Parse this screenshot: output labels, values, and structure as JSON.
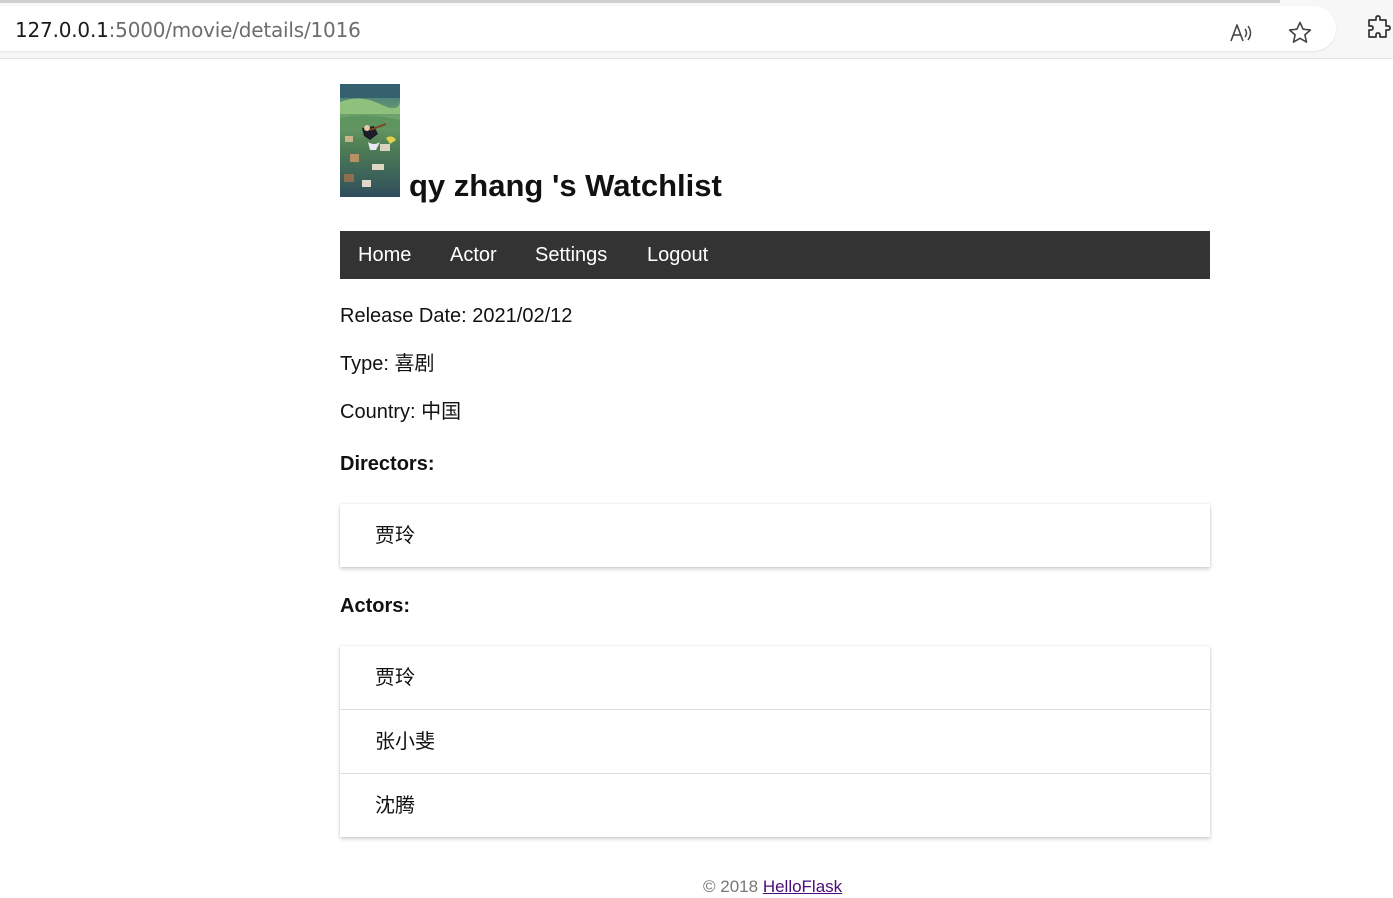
{
  "browser": {
    "url_host": "127.0.0.1",
    "url_path": ":5000/movie/details/1016",
    "icons": [
      "read-aloud-icon",
      "favorite-star-icon",
      "extensions-icon"
    ]
  },
  "header": {
    "title": "qy zhang 's Watchlist"
  },
  "nav": {
    "items": [
      {
        "label": "Home"
      },
      {
        "label": "Actor"
      },
      {
        "label": "Settings"
      },
      {
        "label": "Logout"
      }
    ]
  },
  "details": {
    "release_date": "Release Date: 2021/02/12",
    "type": "Type: 喜剧",
    "country": "Country: 中国"
  },
  "directors": {
    "heading": "Directors:",
    "items": [
      "贾玲"
    ]
  },
  "actors": {
    "heading": "Actors:",
    "items": [
      "贾玲",
      "张小斐",
      "沈腾"
    ]
  },
  "footer": {
    "copyright": "© 2018",
    "link_label": "HelloFlask"
  },
  "colors": {
    "nav_background": "#333333",
    "nav_text": "#ffffff",
    "footer_link": "#4b0d7a"
  }
}
